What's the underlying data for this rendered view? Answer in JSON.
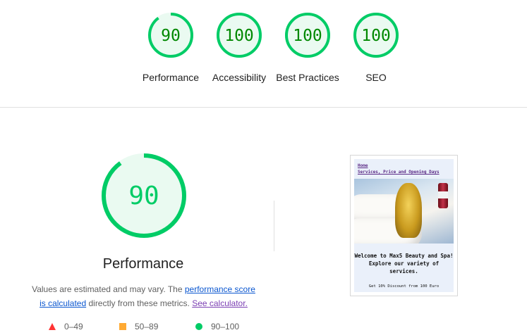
{
  "scores": [
    {
      "name": "performance",
      "value": "90",
      "label": "Performance",
      "fraction": 0.9
    },
    {
      "name": "accessibility",
      "value": "100",
      "label": "Accessibility",
      "fraction": 1.0
    },
    {
      "name": "best-practices",
      "value": "100",
      "label": "Best Practices",
      "fraction": 1.0
    },
    {
      "name": "seo",
      "value": "100",
      "label": "SEO",
      "fraction": 1.0
    }
  ],
  "main": {
    "score": "90",
    "fraction": 0.9,
    "title": "Performance",
    "note_prefix": "Values are estimated and may vary. The ",
    "note_link1": "performance score is calculated",
    "note_middle": " directly from these metrics. ",
    "note_link2": "See calculator."
  },
  "legend": [
    {
      "range": "0–49",
      "icon": "fail-triangle-icon",
      "color": "#ff3333"
    },
    {
      "range": "50–89",
      "icon": "average-square-icon",
      "color": "#ffaa33"
    },
    {
      "range": "90–100",
      "icon": "pass-circle-icon",
      "color": "#00cc66"
    }
  ],
  "colors": {
    "pass": "#00cc66",
    "pass_bg": "#eafaf1",
    "pass_text_small": "#008800",
    "link": "#0b57d0",
    "link_visited": "#7b3fb3"
  },
  "screenshot": {
    "nav_home": "Home",
    "nav_services": "Services, Price and Opening Days",
    "headline": "Welcome to Max5 Beauty and Spa! Explore our variety of services.",
    "offer": "Get 10% Discount from 100 Euro"
  }
}
